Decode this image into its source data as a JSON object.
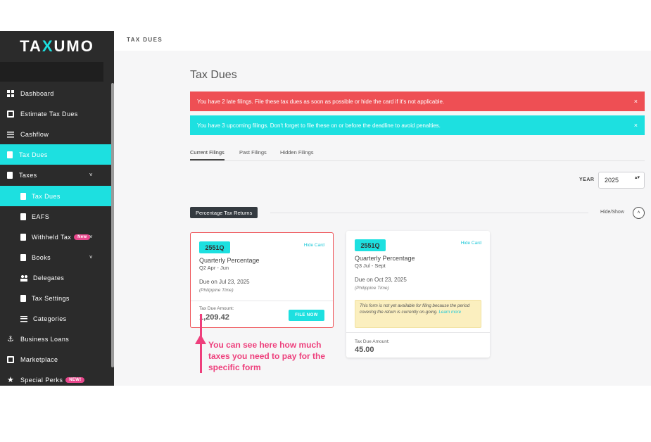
{
  "app": {
    "logo_left": "TA",
    "logo_accent": "X",
    "logo_right": "UMO"
  },
  "topbar": {
    "title": "TAX DUES"
  },
  "sidebar": {
    "items": [
      {
        "label": "Dashboard",
        "icon": "grid-icon"
      },
      {
        "label": "Estimate Tax Dues",
        "icon": "calculator-icon"
      },
      {
        "label": "Cashflow",
        "icon": "money-icon"
      },
      {
        "label": "Tax Dues",
        "icon": "document-icon"
      },
      {
        "label": "Taxes",
        "icon": "document-icon",
        "chevron": "˅"
      },
      {
        "label": "Tax Dues",
        "icon": "document-icon"
      },
      {
        "label": "EAFS",
        "icon": "document-icon"
      },
      {
        "label": "Withheld Tax",
        "icon": "document-icon",
        "badge": "New",
        "chevron": "˅"
      },
      {
        "label": "Books",
        "icon": "book-icon",
        "chevron": "˅"
      },
      {
        "label": "Delegates",
        "icon": "people-icon"
      },
      {
        "label": "Tax Settings",
        "icon": "settings-icon"
      },
      {
        "label": "Categories",
        "icon": "list-icon"
      },
      {
        "label": "Business Loans",
        "icon": "loan-icon"
      },
      {
        "label": "Marketplace",
        "icon": "store-icon"
      },
      {
        "label": "Special Perks",
        "icon": "star-icon",
        "badge": "NEW!"
      }
    ]
  },
  "main": {
    "title": "Tax Dues",
    "alerts": {
      "late": "You have 2 late filings. File these tax dues as soon as possible or hide the card if it's not applicable.",
      "upcoming": "You have 3 upcoming filings. Don't forget to file these on or before the deadline to avoid penalties.",
      "close": "×"
    },
    "tabs": [
      "Current Filings",
      "Past Filings",
      "Hidden Filings"
    ],
    "year": {
      "label": "YEAR",
      "value": "2025",
      "arrows": "▴▾"
    },
    "section": {
      "label": "Percentage Tax Returns",
      "toggle": "Hide/Show",
      "toggle_icon": "˄"
    },
    "cards": [
      {
        "form": "2551Q",
        "hide": "Hide Card",
        "title": "Quarterly Percentage",
        "period": "Q2 Apr - Jun",
        "due": "Due on Jul 23, 2025",
        "tz": "(Philippine Time)",
        "amount_label": "Tax Due Amount:",
        "amount": "1,209.42",
        "button": "FILE NOW"
      },
      {
        "form": "2551Q",
        "hide": "Hide Card",
        "title": "Quarterly Percentage",
        "period": "Q3 Jul - Sept",
        "due": "Due on Oct 23, 2025",
        "tz": "(Philippine Time)",
        "notice": "This form is not yet available for filing because the period covering the return is currently on-going.",
        "notice_link": "Learn more",
        "amount_label": "Tax Due Amount:",
        "amount": "45.00"
      }
    ]
  },
  "annotation": {
    "text": "You can see here how much taxes you need to pay for the specific form"
  },
  "colors": {
    "accent": "#1de0e0",
    "danger": "#ee4f54",
    "sidebar": "#2b2b2b",
    "annotation": "#ee3f7c"
  }
}
